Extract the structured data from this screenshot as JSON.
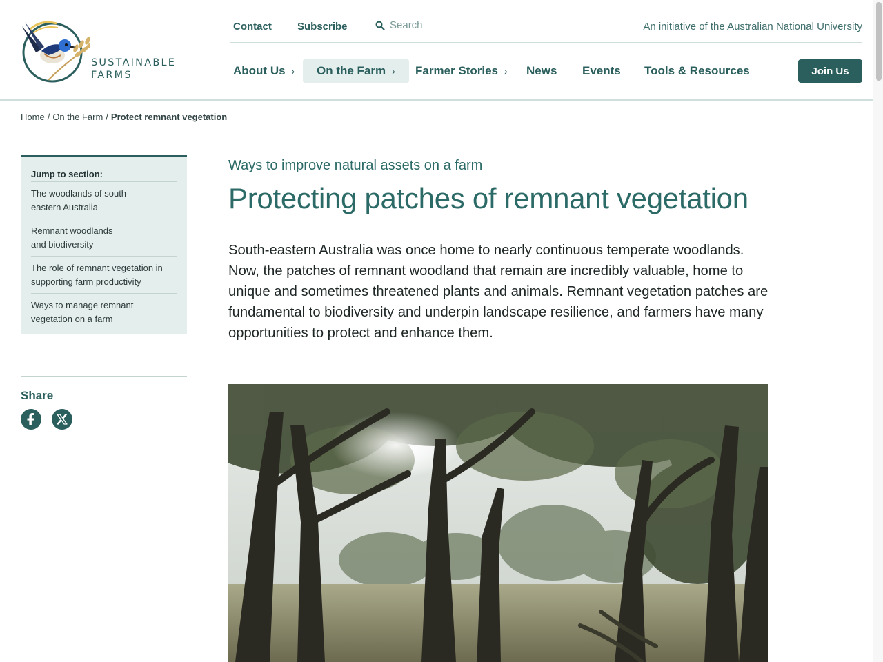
{
  "header": {
    "logo": {
      "line1": "SUSTAINABLE",
      "line2": "FARMS",
      "icon": "fairy-wren-wheat-logo"
    },
    "util_links": [
      "Contact",
      "Subscribe"
    ],
    "search": {
      "placeholder": "Search",
      "icon": "search-icon"
    },
    "initiative": "An initiative of the Australian National University",
    "nav": [
      {
        "label": "About Us",
        "has_submenu": true
      },
      {
        "label": "On the Farm",
        "has_submenu": true,
        "active": true
      },
      {
        "label": "Farmer Stories",
        "has_submenu": true
      },
      {
        "label": "News",
        "has_submenu": false
      },
      {
        "label": "Events",
        "has_submenu": false
      },
      {
        "label": "Tools & Resources",
        "has_submenu": false
      }
    ],
    "join_label": "Join Us"
  },
  "breadcrumb": {
    "items": [
      "Home",
      "On the Farm"
    ],
    "current": "Protect remnant vegetation",
    "separator": "/"
  },
  "sidebar": {
    "jump_title": "Jump to section:",
    "jump_items": [
      "The woodlands of south-\neastern Australia",
      "Remnant woodlands\nand biodiversity",
      "The role of remnant vegetation in\nsupporting farm productivity",
      "Ways to manage remnant\nvegetation on a farm"
    ],
    "share_label": "Share",
    "share_icons": [
      "facebook-icon",
      "x-icon"
    ]
  },
  "main": {
    "kicker": "Ways to improve natural assets on a farm",
    "title": "Protecting patches of remnant vegetation",
    "intro": "South-eastern Australia was once home to nearly continuous temperate woodlands. Now, the patches of remnant woodland that remain are incredibly valuable, home to unique and sometimes threatened plants and animals. Remnant vegetation patches are fundamental to biodiversity and underpin landscape resilience, and farmers have many opportunities to protect and enhance them.",
    "hero_image": "woodland-photo"
  },
  "colors": {
    "brand": "#2b5f5d",
    "brand_light": "#e4eeec",
    "heading": "#2b6a66",
    "divider": "#cfdfdb"
  }
}
